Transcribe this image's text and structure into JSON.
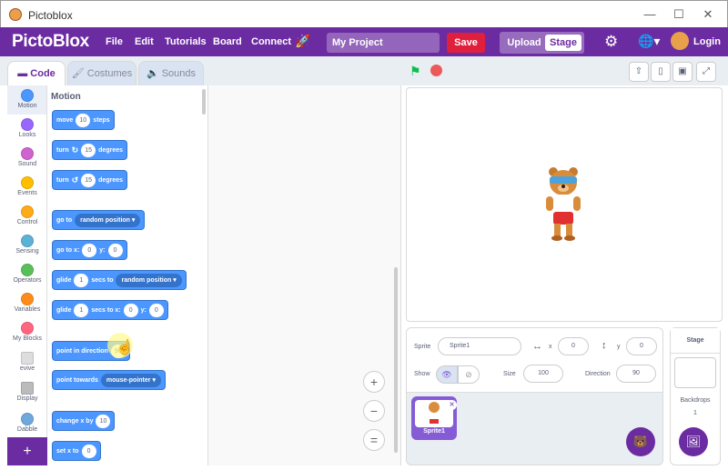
{
  "window": {
    "title": "Pictoblox",
    "minimize": "—",
    "maximize": "☐",
    "close": "✕"
  },
  "menubar": {
    "logo": "PictoBlox",
    "menus": [
      "File",
      "Edit",
      "Tutorials",
      "Board",
      "Connect"
    ],
    "project_name": "My Project",
    "save": "Save",
    "mode_upload": "Upload",
    "mode_stage": "Stage",
    "login": "Login"
  },
  "tabs": {
    "code": "Code",
    "costumes": "Costumes",
    "sounds": "Sounds"
  },
  "categories": [
    {
      "label": "Motion",
      "color": "#4c97ff"
    },
    {
      "label": "Looks",
      "color": "#9966ff"
    },
    {
      "label": "Sound",
      "color": "#cf63cf"
    },
    {
      "label": "Events",
      "color": "#ffbf00"
    },
    {
      "label": "Control",
      "color": "#ffab19"
    },
    {
      "label": "Sensing",
      "color": "#5cb1d6"
    },
    {
      "label": "Operators",
      "color": "#59c059"
    },
    {
      "label": "Variables",
      "color": "#ff8c1a"
    },
    {
      "label": "My Blocks",
      "color": "#ff6680"
    },
    {
      "label": "evive",
      "color": "#cccccc"
    },
    {
      "label": "Display",
      "color": "#cccccc"
    },
    {
      "label": "Dabble",
      "color": "#cccccc"
    }
  ],
  "palette": {
    "title": "Motion",
    "blocks": {
      "move": {
        "pre": "move",
        "val": "10",
        "post": "steps"
      },
      "turn_cw": {
        "pre": "turn",
        "icon": "↻",
        "val": "15",
        "post": "degrees"
      },
      "turn_ccw": {
        "pre": "turn",
        "icon": "↺",
        "val": "15",
        "post": "degrees"
      },
      "goto": {
        "pre": "go to",
        "drop": "random position ▾"
      },
      "gotoxy": {
        "pre": "go to x:",
        "x": "0",
        "ylbl": "y:",
        "y": "0"
      },
      "glide1": {
        "pre": "glide",
        "val": "1",
        "mid": "secs to",
        "drop": "random position ▾"
      },
      "glide2": {
        "pre": "glide",
        "val": "1",
        "mid": "secs to x:",
        "x": "0",
        "ylbl": "y:",
        "y": "0"
      },
      "point": {
        "pre": "point in direction",
        "val": "90"
      },
      "towards": {
        "pre": "point towards",
        "drop": "mouse-pointer ▾"
      },
      "changex": {
        "pre": "change x by",
        "val": "10"
      },
      "setx": {
        "pre": "set x to",
        "val": "0"
      }
    }
  },
  "zoom": {
    "in": "+",
    "out": "−",
    "reset": "="
  },
  "sprite_info": {
    "sprite_label": "Sprite",
    "sprite_name": "Sprite1",
    "x_label": "x",
    "x": "0",
    "y_label": "y",
    "y": "0",
    "show_label": "Show",
    "size_label": "Size",
    "size": "100",
    "direction_label": "Direction",
    "direction": "90"
  },
  "sprites": [
    {
      "name": "Sprite1"
    }
  ],
  "stage_panel": {
    "title": "Stage",
    "backdrops_label": "Backdrops",
    "backdrops_count": "1"
  }
}
